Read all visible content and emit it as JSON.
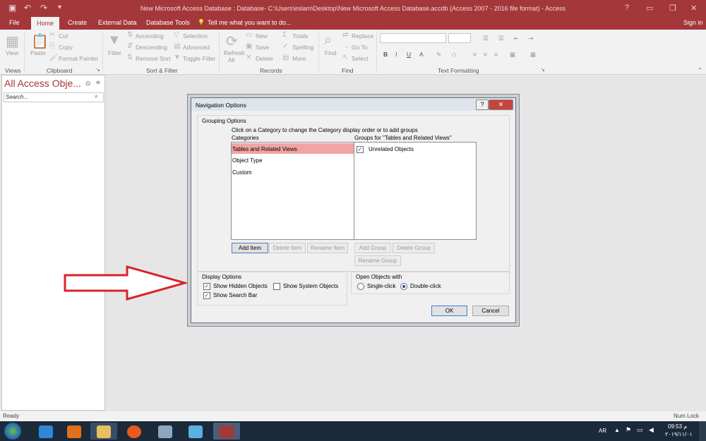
{
  "window": {
    "title": "New Microsoft Access Database : Database- C:\\Users\\eslam\\Desktop\\New Microsoft Access Database.accdb (Access 2007 - 2016 file format) - Access",
    "help": "?",
    "sign_in": "Sign in"
  },
  "tabs": [
    {
      "label": "File"
    },
    {
      "label": "Home"
    },
    {
      "label": "Create"
    },
    {
      "label": "External Data"
    },
    {
      "label": "Database Tools"
    },
    {
      "label": "Tell me what you want to do..."
    }
  ],
  "ribbon": {
    "views": {
      "view": "View",
      "label": "Views"
    },
    "clipboard": {
      "paste": "Paste",
      "cut": "Cut",
      "copy": "Copy",
      "format_painter": "Format Painter",
      "label": "Clipboard"
    },
    "sort_filter": {
      "filter": "Filter",
      "ascending": "Ascending",
      "descending": "Descending",
      "remove_sort": "Remove Sort",
      "selection": "Selection",
      "advanced": "Advanced",
      "toggle_filter": "Toggle Filter",
      "label": "Sort & Filter"
    },
    "records": {
      "refresh": "Refresh",
      "all": "All",
      "new": "New",
      "save": "Save",
      "delete": "Delete",
      "totals": "Totals",
      "spelling": "Spelling",
      "more": "More",
      "label": "Records"
    },
    "find": {
      "find": "Find",
      "replace": "Replace",
      "goto": "Go To",
      "select": "Select",
      "label": "Find"
    },
    "text_formatting": {
      "bold": "B",
      "italic": "I",
      "underline": "U",
      "font_color": "A",
      "label": "Text Formatting"
    }
  },
  "nav_pane": {
    "title": "All Access Obje...",
    "search_placeholder": "Search..."
  },
  "dialog": {
    "title": "Navigation Options",
    "help": "?",
    "close": "✕",
    "grouping_options": "Grouping Options",
    "instruction": "Click on a Category to change the Category display order or to add groups",
    "categories_label": "Categories",
    "groups_label": "Groups for \"Tables and Related Views\"",
    "categories": [
      {
        "label": "Tables and Related Views",
        "selected": true
      },
      {
        "label": "Object Type",
        "selected": false
      },
      {
        "label": "Custom",
        "selected": false
      }
    ],
    "groups": [
      {
        "label": "Unrelated Objects",
        "checked": true
      }
    ],
    "buttons": {
      "add_item": "Add Item",
      "delete_item": "Delete Item",
      "rename_item": "Rename Item",
      "add_group": "Add Group",
      "delete_group": "Delete Group",
      "rename_group": "Rename Group"
    },
    "display_options": {
      "label": "Display Options",
      "show_hidden": "Show Hidden Objects",
      "show_hidden_checked": true,
      "show_system": "Show System Objects",
      "show_system_checked": false,
      "show_search": "Show Search Bar",
      "show_search_checked": true
    },
    "open_objects": {
      "label": "Open Objects with",
      "single": "Single-click",
      "double": "Double-click",
      "selected": "double"
    },
    "ok": "OK",
    "cancel": "Cancel"
  },
  "status": {
    "left": "Ready",
    "right": "Num Lock"
  },
  "taskbar": {
    "lang": "AR",
    "time": "09:53 م",
    "date": "٢٠١٩/١١/٠١"
  },
  "colors": {
    "accent": "#a4373a",
    "arrow": "#d8232a",
    "taskbar": "#1b2a3a"
  }
}
